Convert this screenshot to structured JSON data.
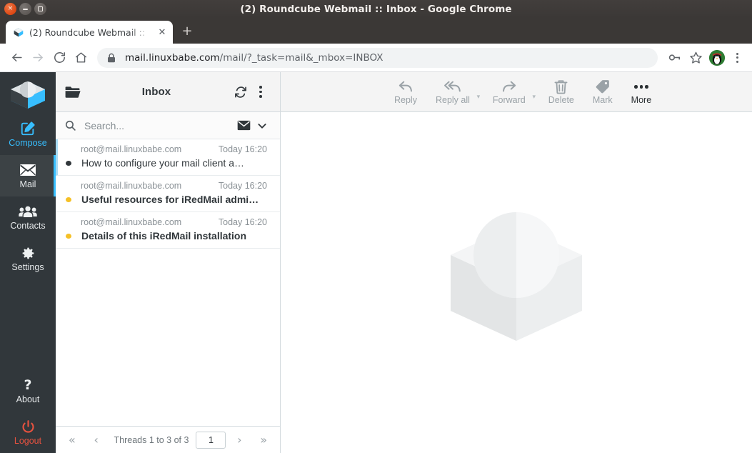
{
  "window": {
    "title": "(2) Roundcube Webmail :: Inbox - Google Chrome",
    "close_label": "×",
    "minimize_label": "−",
    "maximize_label": "□"
  },
  "browser": {
    "tab": {
      "title": "(2) Roundcube Webmail ::",
      "favicon": "roundcube-logo-icon",
      "close_label": "✕"
    },
    "new_tab_label": "+",
    "nav": {
      "back": "back-arrow-icon",
      "forward": "forward-arrow-icon",
      "reload": "reload-icon",
      "home": "home-icon"
    },
    "omnibox": {
      "lock_icon": "lock-icon",
      "host": "mail.linuxbabe.com",
      "path": "/mail/?_task=mail&_mbox=INBOX"
    },
    "actions": {
      "password_key": "key-icon",
      "bookmark_star": "star-icon",
      "profile": "penguin-avatar",
      "menu": "three-dots-vertical-icon"
    }
  },
  "sidebar": {
    "logo": "roundcube-logo",
    "items": [
      {
        "label": "Compose",
        "icon": "compose-pencil-icon",
        "state": "accent"
      },
      {
        "label": "Mail",
        "icon": "envelope-icon",
        "state": "active"
      },
      {
        "label": "Contacts",
        "icon": "contacts-people-icon",
        "state": "normal"
      },
      {
        "label": "Settings",
        "icon": "gear-icon",
        "state": "normal"
      }
    ],
    "bottom_items": [
      {
        "label": "About",
        "icon": "question-mark-icon",
        "state": "normal"
      },
      {
        "label": "Logout",
        "icon": "power-icon",
        "state": "danger"
      }
    ],
    "colors": {
      "accent": "#37beff",
      "danger": "#e8523f",
      "background": "#31373b",
      "active_bg": "#3c4245"
    }
  },
  "maillist": {
    "header": {
      "folder_icon": "folder-open-icon",
      "title": "Inbox",
      "refresh_icon": "refresh-icon",
      "options_icon": "three-dots-vertical-icon"
    },
    "search": {
      "icon": "search-icon",
      "placeholder": "Search...",
      "value": "",
      "scope_icon": "envelope-icon",
      "expand_icon": "chevron-down-icon"
    },
    "messages": [
      {
        "from": "root@mail.linuxbabe.com",
        "date": "Today 16:20",
        "subject": "How to configure your mail client a…",
        "unread": false,
        "focused": true
      },
      {
        "from": "root@mail.linuxbabe.com",
        "date": "Today 16:20",
        "subject": "Useful resources for iRedMail admi…",
        "unread": true,
        "focused": false
      },
      {
        "from": "root@mail.linuxbabe.com",
        "date": "Today 16:20",
        "subject": "Details of this iRedMail installation",
        "unread": true,
        "focused": false
      }
    ],
    "footer": {
      "first_label": "«",
      "prev_label": "‹",
      "count_text": "Threads 1 to 3 of 3",
      "page_value": "1",
      "next_label": "›",
      "last_label": "»"
    }
  },
  "content_toolbar": {
    "items": [
      {
        "label": "Reply",
        "icon": "reply-arrow-icon",
        "enabled": false,
        "caret": false
      },
      {
        "label": "Reply all",
        "icon": "reply-all-arrow-icon",
        "enabled": false,
        "caret": true
      },
      {
        "label": "Forward",
        "icon": "forward-arrow-icon",
        "enabled": false,
        "caret": true
      },
      {
        "label": "Delete",
        "icon": "trash-icon",
        "enabled": false,
        "caret": false
      },
      {
        "label": "Mark",
        "icon": "tag-icon",
        "enabled": false,
        "caret": false
      },
      {
        "label": "More",
        "icon": "three-dots-horizontal-icon",
        "enabled": true,
        "caret": false
      }
    ]
  },
  "content": {
    "watermark": "roundcube-logo-watermark"
  }
}
